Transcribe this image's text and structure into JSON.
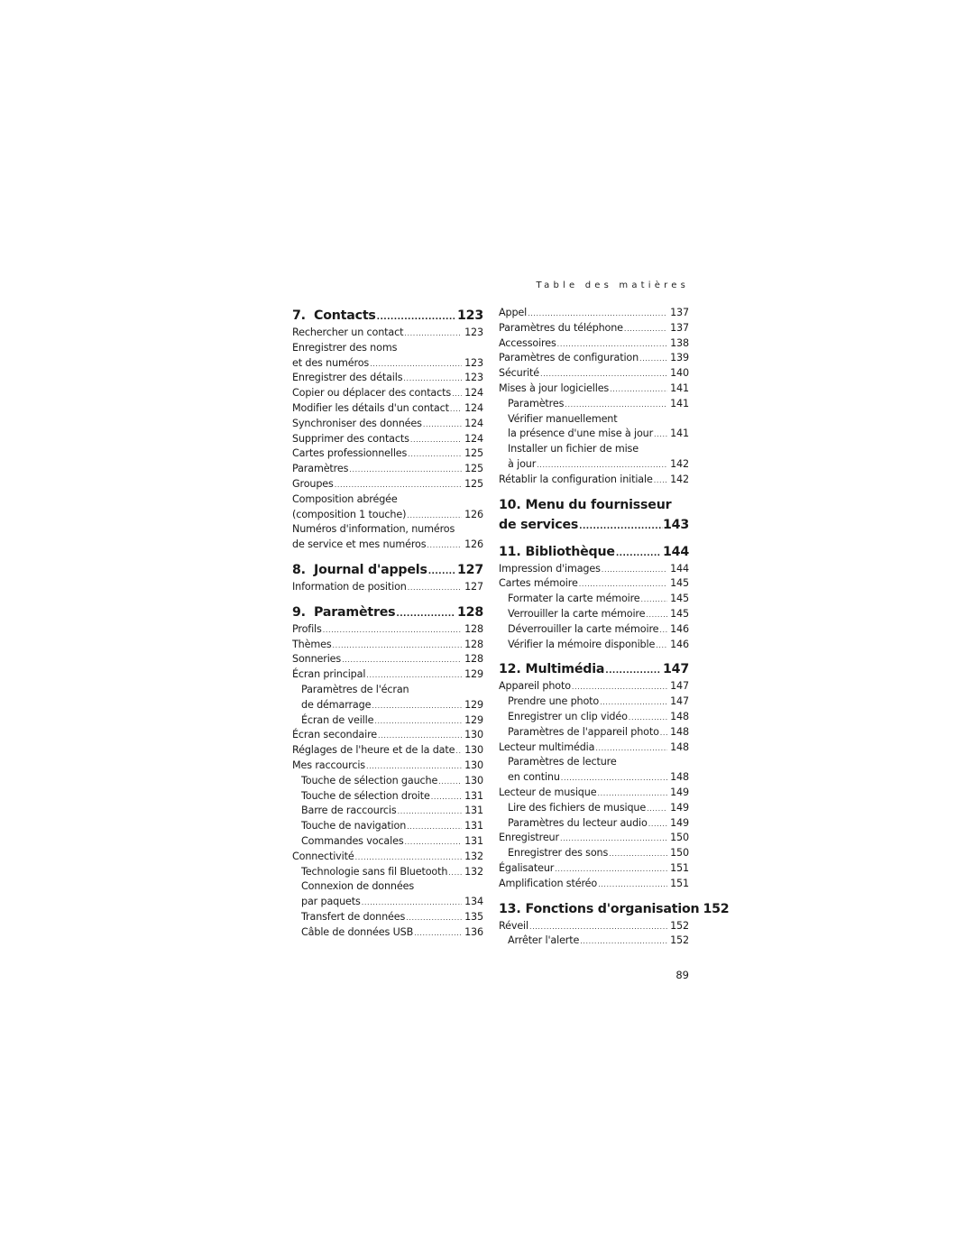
{
  "running_head": "Table des matières",
  "page_number": "89",
  "left_column": [
    {
      "type": "head",
      "num": "7.",
      "label": "Contacts",
      "page": "123"
    },
    {
      "type": "entry",
      "label": "Rechercher un contact",
      "page": "123",
      "indent": false
    },
    {
      "type": "entry",
      "label": "Enregistrer des noms",
      "page": "",
      "indent": false
    },
    {
      "type": "entry",
      "label": "et des numéros",
      "page": "123",
      "indent": false
    },
    {
      "type": "entry",
      "label": "Enregistrer des détails",
      "page": "123",
      "indent": false
    },
    {
      "type": "entry",
      "label": "Copier ou déplacer des contacts",
      "page": "124",
      "indent": false
    },
    {
      "type": "entry",
      "label": "Modifier les détails d'un contact",
      "page": "124",
      "indent": false
    },
    {
      "type": "entry",
      "label": "Synchroniser des données",
      "page": "124",
      "indent": false
    },
    {
      "type": "entry",
      "label": "Supprimer des contacts",
      "page": "124",
      "indent": false
    },
    {
      "type": "entry",
      "label": "Cartes professionnelles",
      "page": "125",
      "indent": false
    },
    {
      "type": "entry",
      "label": "Paramètres",
      "page": "125",
      "indent": false
    },
    {
      "type": "entry",
      "label": "Groupes",
      "page": "125",
      "indent": false
    },
    {
      "type": "entry",
      "label": "Composition abrégée",
      "page": "",
      "indent": false
    },
    {
      "type": "entry",
      "label": "(composition 1 touche)",
      "page": "126",
      "indent": false
    },
    {
      "type": "entry",
      "label": "Numéros d'information, numéros",
      "page": "",
      "indent": false
    },
    {
      "type": "entry",
      "label": "de service et mes numéros",
      "page": "126",
      "indent": false
    },
    {
      "type": "gap"
    },
    {
      "type": "head",
      "num": "8.",
      "label": "Journal d'appels",
      "page": "127"
    },
    {
      "type": "entry",
      "label": "Information de position",
      "page": "127",
      "indent": false
    },
    {
      "type": "gap"
    },
    {
      "type": "head",
      "num": "9.",
      "label": "Paramètres",
      "page": "128"
    },
    {
      "type": "entry",
      "label": "Profils",
      "page": "128",
      "indent": false
    },
    {
      "type": "entry",
      "label": "Thèmes",
      "page": "128",
      "indent": false
    },
    {
      "type": "entry",
      "label": "Sonneries",
      "page": "128",
      "indent": false
    },
    {
      "type": "entry",
      "label": "Écran principal",
      "page": "129",
      "indent": false
    },
    {
      "type": "entry",
      "label": "Paramètres de l'écran",
      "page": "",
      "indent": true
    },
    {
      "type": "entry",
      "label": "de démarrage",
      "page": "129",
      "indent": true
    },
    {
      "type": "entry",
      "label": "Écran de veille",
      "page": "129",
      "indent": true
    },
    {
      "type": "entry",
      "label": "Écran secondaire",
      "page": "130",
      "indent": false
    },
    {
      "type": "entry",
      "label": "Réglages de l'heure et de la date",
      "page": "130",
      "indent": false
    },
    {
      "type": "entry",
      "label": "Mes raccourcis",
      "page": "130",
      "indent": false
    },
    {
      "type": "entry",
      "label": "Touche de sélection gauche",
      "page": "130",
      "indent": true
    },
    {
      "type": "entry",
      "label": "Touche de sélection droite",
      "page": "131",
      "indent": true
    },
    {
      "type": "entry",
      "label": "Barre de raccourcis",
      "page": "131",
      "indent": true
    },
    {
      "type": "entry",
      "label": "Touche de navigation",
      "page": "131",
      "indent": true
    },
    {
      "type": "entry",
      "label": "Commandes vocales",
      "page": "131",
      "indent": true
    },
    {
      "type": "entry",
      "label": "Connectivité",
      "page": "132",
      "indent": false
    },
    {
      "type": "entry",
      "label": "Technologie sans fil Bluetooth",
      "page": "132",
      "indent": true
    },
    {
      "type": "entry",
      "label": "Connexion de données",
      "page": "",
      "indent": true
    },
    {
      "type": "entry",
      "label": "par paquets",
      "page": "134",
      "indent": true
    },
    {
      "type": "entry",
      "label": "Transfert de données",
      "page": "135",
      "indent": true
    },
    {
      "type": "entry",
      "label": "Câble de données USB",
      "page": "136",
      "indent": true
    }
  ],
  "right_column": [
    {
      "type": "entry",
      "label": "Appel",
      "page": "137",
      "indent": false
    },
    {
      "type": "entry",
      "label": "Paramètres du téléphone",
      "page": "137",
      "indent": false
    },
    {
      "type": "entry",
      "label": "Accessoires",
      "page": "138",
      "indent": false
    },
    {
      "type": "entry",
      "label": "Paramètres de configuration",
      "page": "139",
      "indent": false
    },
    {
      "type": "entry",
      "label": "Sécurité",
      "page": "140",
      "indent": false
    },
    {
      "type": "entry",
      "label": "Mises à jour logicielles",
      "page": "141",
      "indent": false
    },
    {
      "type": "entry",
      "label": "Paramètres",
      "page": "141",
      "indent": true
    },
    {
      "type": "entry",
      "label": "Vérifier manuellement",
      "page": "",
      "indent": true
    },
    {
      "type": "entry",
      "label": "la présence d'une mise à jour",
      "page": "141",
      "indent": true
    },
    {
      "type": "entry",
      "label": "Installer un fichier de mise",
      "page": "",
      "indent": true
    },
    {
      "type": "entry",
      "label": "à jour",
      "page": "142",
      "indent": true
    },
    {
      "type": "entry",
      "label": "Rétablir la configuration initiale",
      "page": "142",
      "indent": false
    },
    {
      "type": "gap"
    },
    {
      "type": "head2",
      "num": "10.",
      "line1": "Menu du fournisseur",
      "line2": "de services",
      "page": "143"
    },
    {
      "type": "gap"
    },
    {
      "type": "head",
      "num": "11.",
      "label": "Bibliothèque",
      "page": "144"
    },
    {
      "type": "entry",
      "label": "Impression d'images",
      "page": "144",
      "indent": false
    },
    {
      "type": "entry",
      "label": "Cartes mémoire",
      "page": "145",
      "indent": false
    },
    {
      "type": "entry",
      "label": "Formater la carte mémoire",
      "page": "145",
      "indent": true
    },
    {
      "type": "entry",
      "label": "Verrouiller la carte mémoire",
      "page": "145",
      "indent": true
    },
    {
      "type": "entry",
      "label": "Déverrouiller la carte mémoire",
      "page": "146",
      "indent": true
    },
    {
      "type": "entry",
      "label": "Vérifier la mémoire disponible",
      "page": "146",
      "indent": true
    },
    {
      "type": "gap"
    },
    {
      "type": "head",
      "num": "12.",
      "label": "Multimédia",
      "page": "147"
    },
    {
      "type": "entry",
      "label": "Appareil photo",
      "page": "147",
      "indent": false
    },
    {
      "type": "entry",
      "label": "Prendre une photo",
      "page": "147",
      "indent": true
    },
    {
      "type": "entry",
      "label": "Enregistrer un clip vidéo",
      "page": "148",
      "indent": true
    },
    {
      "type": "entry",
      "label": "Paramètres de l'appareil photo",
      "page": "148",
      "indent": true
    },
    {
      "type": "entry",
      "label": "Lecteur multimédia",
      "page": "148",
      "indent": false
    },
    {
      "type": "entry",
      "label": "Paramètres de lecture",
      "page": "",
      "indent": true
    },
    {
      "type": "entry",
      "label": "en continu",
      "page": "148",
      "indent": true
    },
    {
      "type": "entry",
      "label": "Lecteur de musique",
      "page": "149",
      "indent": false
    },
    {
      "type": "entry",
      "label": "Lire des fichiers de musique",
      "page": "149",
      "indent": true
    },
    {
      "type": "entry",
      "label": "Paramètres du lecteur audio",
      "page": "149",
      "indent": true
    },
    {
      "type": "entry",
      "label": "Enregistreur",
      "page": "150",
      "indent": false
    },
    {
      "type": "entry",
      "label": "Enregistrer des sons",
      "page": "150",
      "indent": true
    },
    {
      "type": "entry",
      "label": "Égalisateur",
      "page": "151",
      "indent": false
    },
    {
      "type": "entry",
      "label": "Amplification stéréo",
      "page": "151",
      "indent": false
    },
    {
      "type": "gap"
    },
    {
      "type": "head",
      "num": "13.",
      "label": "Fonctions d'organisation",
      "page": "152"
    },
    {
      "type": "entry",
      "label": "Réveil",
      "page": "152",
      "indent": false
    },
    {
      "type": "entry",
      "label": "Arrêter l'alerte",
      "page": "152",
      "indent": true
    }
  ]
}
